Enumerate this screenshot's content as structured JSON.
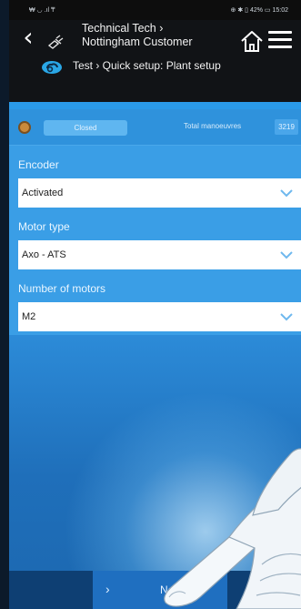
{
  "status_bar": {
    "left": "₩ ◡ .ıl ₸",
    "right": "⊕ ✱ ▯ 42% ▭ 15:02"
  },
  "header": {
    "title_line1": "Technical Tech ›",
    "title_line2": "Nottingham Customer",
    "breadcrumb": "Test › Quick setup: Plant setup"
  },
  "status_row": {
    "pill_label": "Closed",
    "total_label": "Total manoeuvres",
    "total_value": "3219"
  },
  "form": {
    "encoder_label": "Encoder",
    "encoder_value": "Activated",
    "motor_type_label": "Motor type",
    "motor_type_value": "Axo - ATS",
    "motors_label": "Number of motors",
    "motors_value": "M2"
  },
  "footer": {
    "next_chevron": "›",
    "next_label": "Next"
  },
  "colors": {
    "accent": "#2a9ae8",
    "header": "#111316",
    "status_dot": "#c98a3c",
    "next_bar": "#1f6fc0"
  },
  "icons": [
    "back-chevron-icon",
    "plug-icon",
    "home-icon",
    "menu-icon",
    "cloud-icon",
    "chevron-down-icon"
  ]
}
